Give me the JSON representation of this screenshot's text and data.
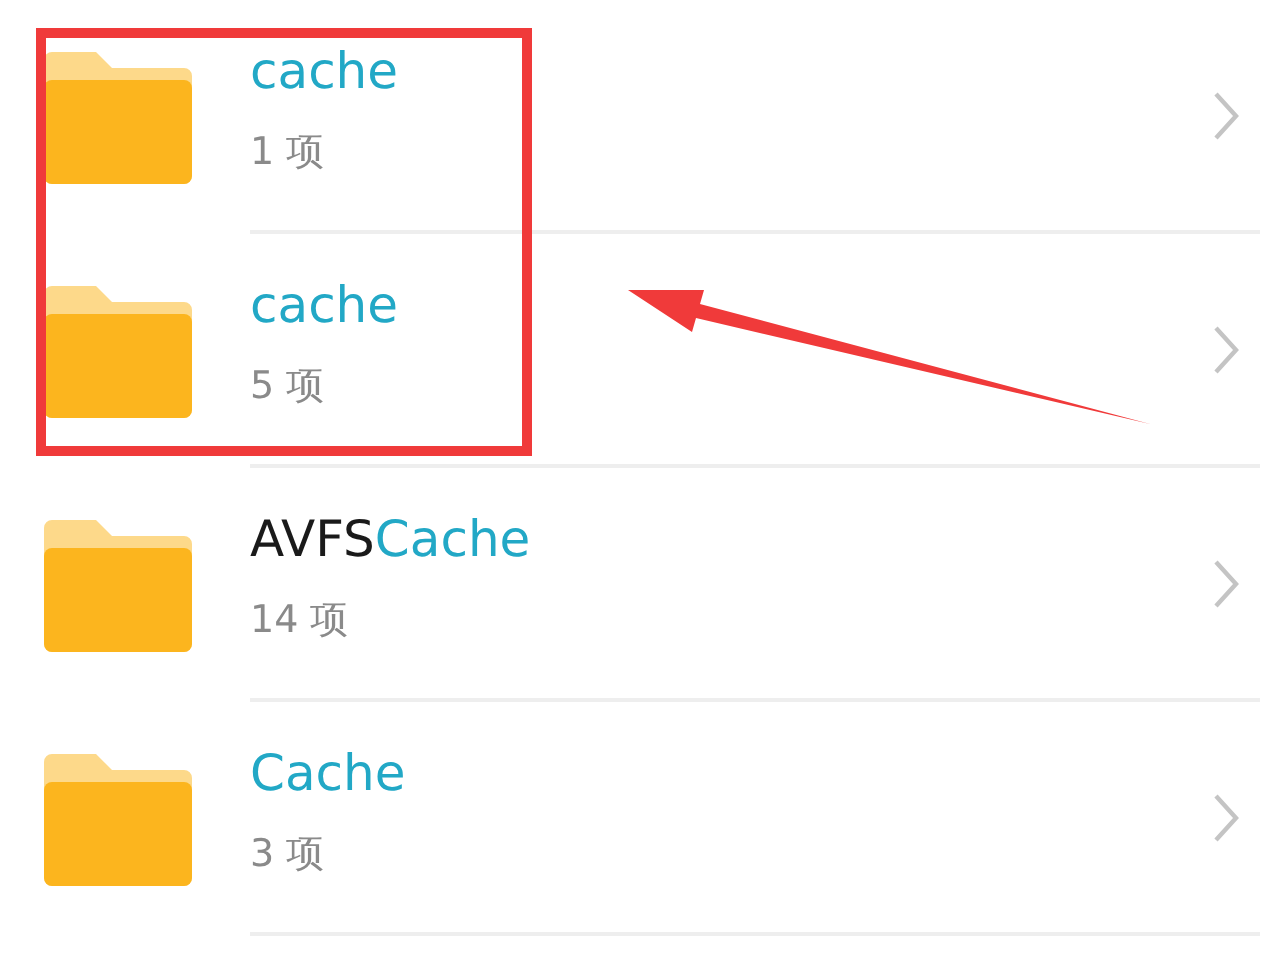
{
  "files": [
    {
      "name": [
        {
          "text": "cache",
          "highlighted": true
        }
      ],
      "count": "1 项",
      "boxed": true
    },
    {
      "name": [
        {
          "text": "cache",
          "highlighted": true
        }
      ],
      "count": "5 项",
      "boxed": true
    },
    {
      "name": [
        {
          "text": "AVFS",
          "highlighted": false
        },
        {
          "text": "Cache",
          "highlighted": true
        }
      ],
      "count": "14 项",
      "boxed": false
    },
    {
      "name": [
        {
          "text": "Cache",
          "highlighted": true
        }
      ],
      "count": "3 项",
      "boxed": false
    }
  ],
  "annotation": {
    "arrow": true
  }
}
